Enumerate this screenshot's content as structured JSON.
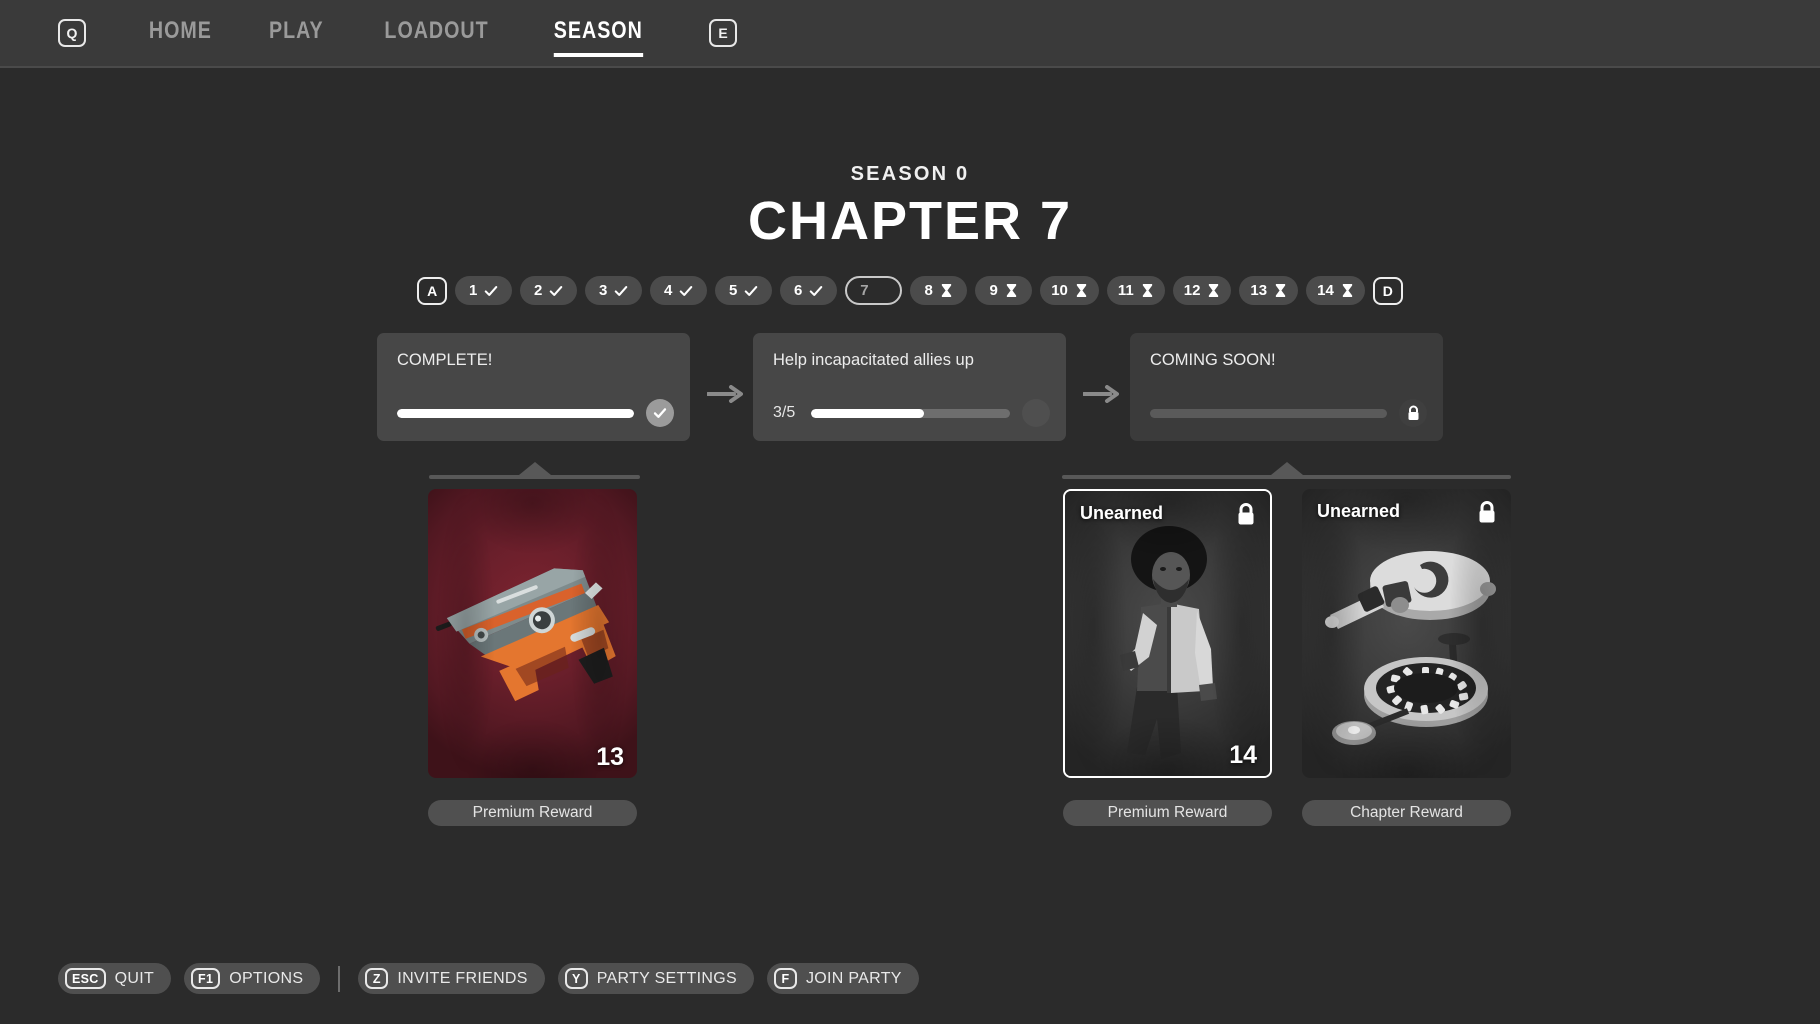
{
  "nav": {
    "left_key": "Q",
    "right_key": "E",
    "items": [
      {
        "label": "HOME",
        "active": false
      },
      {
        "label": "PLAY",
        "active": false
      },
      {
        "label": "LOADOUT",
        "active": false
      },
      {
        "label": "SEASON",
        "active": true
      }
    ]
  },
  "header": {
    "season_label": "SEASON 0",
    "chapter_title": "CHAPTER 7"
  },
  "chapter_selector": {
    "prev_key": "A",
    "next_key": "D",
    "chapters": [
      {
        "number": "1",
        "status": "complete"
      },
      {
        "number": "2",
        "status": "complete"
      },
      {
        "number": "3",
        "status": "complete"
      },
      {
        "number": "4",
        "status": "complete"
      },
      {
        "number": "5",
        "status": "complete"
      },
      {
        "number": "6",
        "status": "complete"
      },
      {
        "number": "7",
        "status": "current"
      },
      {
        "number": "8",
        "status": "locked"
      },
      {
        "number": "9",
        "status": "locked"
      },
      {
        "number": "10",
        "status": "locked"
      },
      {
        "number": "11",
        "status": "locked"
      },
      {
        "number": "12",
        "status": "locked"
      },
      {
        "number": "13",
        "status": "locked"
      },
      {
        "number": "14",
        "status": "locked"
      }
    ]
  },
  "objectives": [
    {
      "title": "COMPLETE!",
      "count": "",
      "progress_percent": 100,
      "state": "complete",
      "badge_icon": "check-icon"
    },
    {
      "title": "Help incapacitated allies up",
      "count": "3/5",
      "progress_percent": 57,
      "state": "in-progress",
      "badge_icon": "none"
    },
    {
      "title": "COMING SOON!",
      "count": "",
      "progress_percent": 0,
      "state": "locked",
      "badge_icon": "lock-icon"
    }
  ],
  "rewards": [
    {
      "id": "weapon",
      "number": "13",
      "state_label": "",
      "locked": false,
      "selected": false,
      "label": "Premium Reward",
      "art": "weapon"
    },
    {
      "id": "character",
      "number": "14",
      "state_label": "Unearned",
      "locked": true,
      "selected": true,
      "label": "Premium Reward",
      "art": "character"
    },
    {
      "id": "gadget",
      "number": "",
      "state_label": "Unearned",
      "locked": true,
      "selected": false,
      "label": "Chapter Reward",
      "art": "gadget"
    }
  ],
  "footer": {
    "buttons": [
      {
        "key": "ESC",
        "label": "QUIT"
      },
      {
        "key": "F1",
        "label": "OPTIONS"
      },
      {
        "key": "Z",
        "label": "INVITE FRIENDS"
      },
      {
        "key": "Y",
        "label": "PARTY SETTINGS"
      },
      {
        "key": "F",
        "label": "JOIN PARTY"
      }
    ],
    "divider_after_index": 1
  },
  "colors": {
    "page_background": "#2b2b2b",
    "nav_background": "#3a3a3a",
    "card_background": "#474747",
    "card_dim_background": "#3b3b3b",
    "accent_white": "#ffffff",
    "muted_text": "#9a9a9a",
    "bar_track": "#6e6e6e",
    "weapon_art_red": "#6a1f2b"
  }
}
